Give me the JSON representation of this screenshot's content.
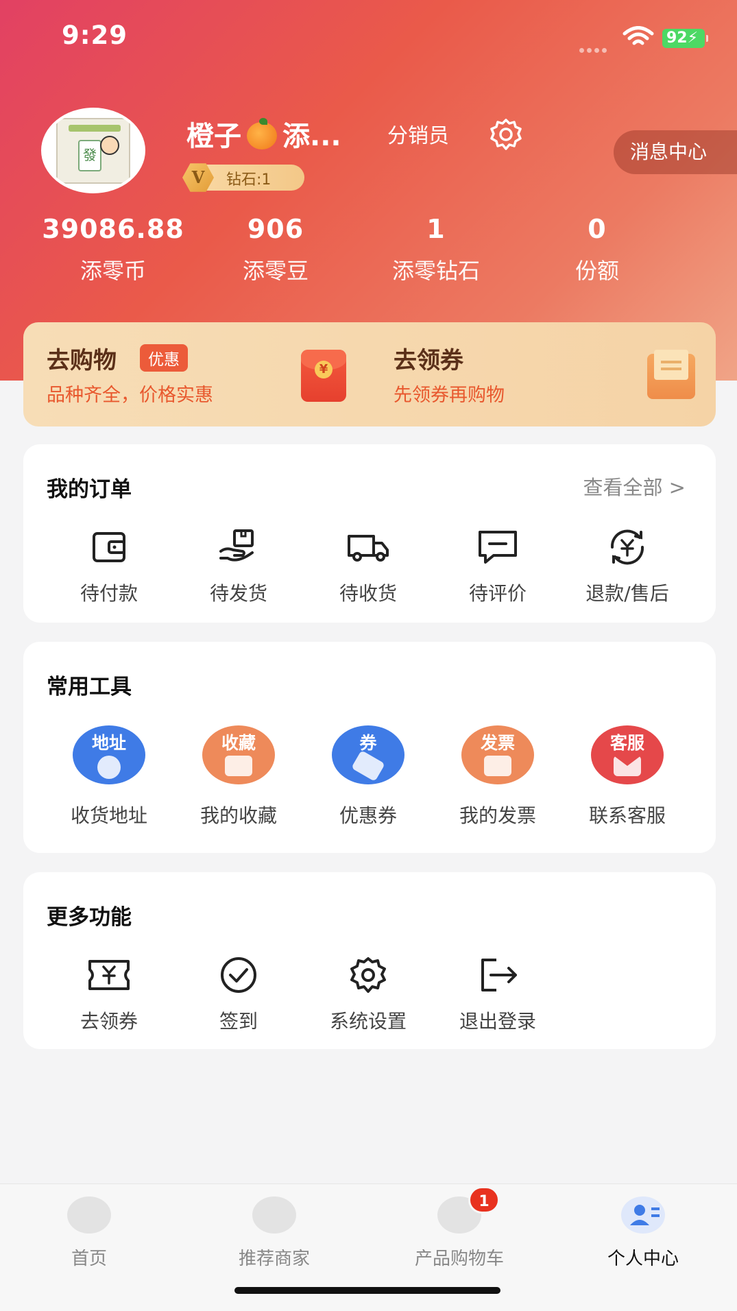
{
  "status_bar": {
    "time": "9:29",
    "battery": "92"
  },
  "profile": {
    "name_part1": "橙子",
    "name_part2": "添...",
    "role": "分销员",
    "vip_text": "钻石:1",
    "vip_letter": "V",
    "message_center": "消息中心",
    "avatar_tile": "發"
  },
  "stats": [
    {
      "value": "39086.88",
      "label": "添零币"
    },
    {
      "value": "906",
      "label": "添零豆"
    },
    {
      "value": "1",
      "label": "添零钻石"
    },
    {
      "value": "0",
      "label": "份额"
    }
  ],
  "promo": {
    "shop_title": "去购物",
    "shop_tag": "优惠",
    "shop_sub": "品种齐全，价格实惠",
    "coupon_title": "去领券",
    "coupon_sub": "先领券再购物"
  },
  "orders": {
    "title": "我的订单",
    "view_all": "查看全部 >",
    "items": [
      {
        "label": "待付款",
        "icon": "wallet-icon"
      },
      {
        "label": "待发货",
        "icon": "package-hand-icon"
      },
      {
        "label": "待收货",
        "icon": "truck-icon"
      },
      {
        "label": "待评价",
        "icon": "comment-icon"
      },
      {
        "label": "退款/售后",
        "icon": "refund-icon"
      }
    ]
  },
  "tools": {
    "title": "常用工具",
    "items": [
      {
        "label": "收货地址",
        "badge": "地址",
        "color": "#3f7be6",
        "icon": "address-icon"
      },
      {
        "label": "我的收藏",
        "badge": "收藏",
        "color": "#ee8a5a",
        "icon": "favorites-icon"
      },
      {
        "label": "优惠券",
        "badge": "券",
        "color": "#3f7be6",
        "icon": "coupon-icon"
      },
      {
        "label": "我的发票",
        "badge": "发票",
        "color": "#ee8a5a",
        "icon": "invoice-icon"
      },
      {
        "label": "联系客服",
        "badge": "客服",
        "color": "#e5484a",
        "icon": "customer-service-icon"
      }
    ]
  },
  "more": {
    "title": "更多功能",
    "items": [
      {
        "label": "去领券",
        "icon": "ticket-icon"
      },
      {
        "label": "签到",
        "icon": "check-circle-icon"
      },
      {
        "label": "系统设置",
        "icon": "gear-icon"
      },
      {
        "label": "退出登录",
        "icon": "logout-icon"
      }
    ]
  },
  "tabbar": {
    "items": [
      {
        "label": "首页",
        "icon": "store-icon"
      },
      {
        "label": "推荐商家",
        "icon": "shopping-bag-icon"
      },
      {
        "label": "产品购物车",
        "icon": "cart-icon"
      },
      {
        "label": "个人中心",
        "icon": "profile-card-icon"
      }
    ],
    "cart_badge": "1",
    "active_color": "#3f7be6"
  }
}
